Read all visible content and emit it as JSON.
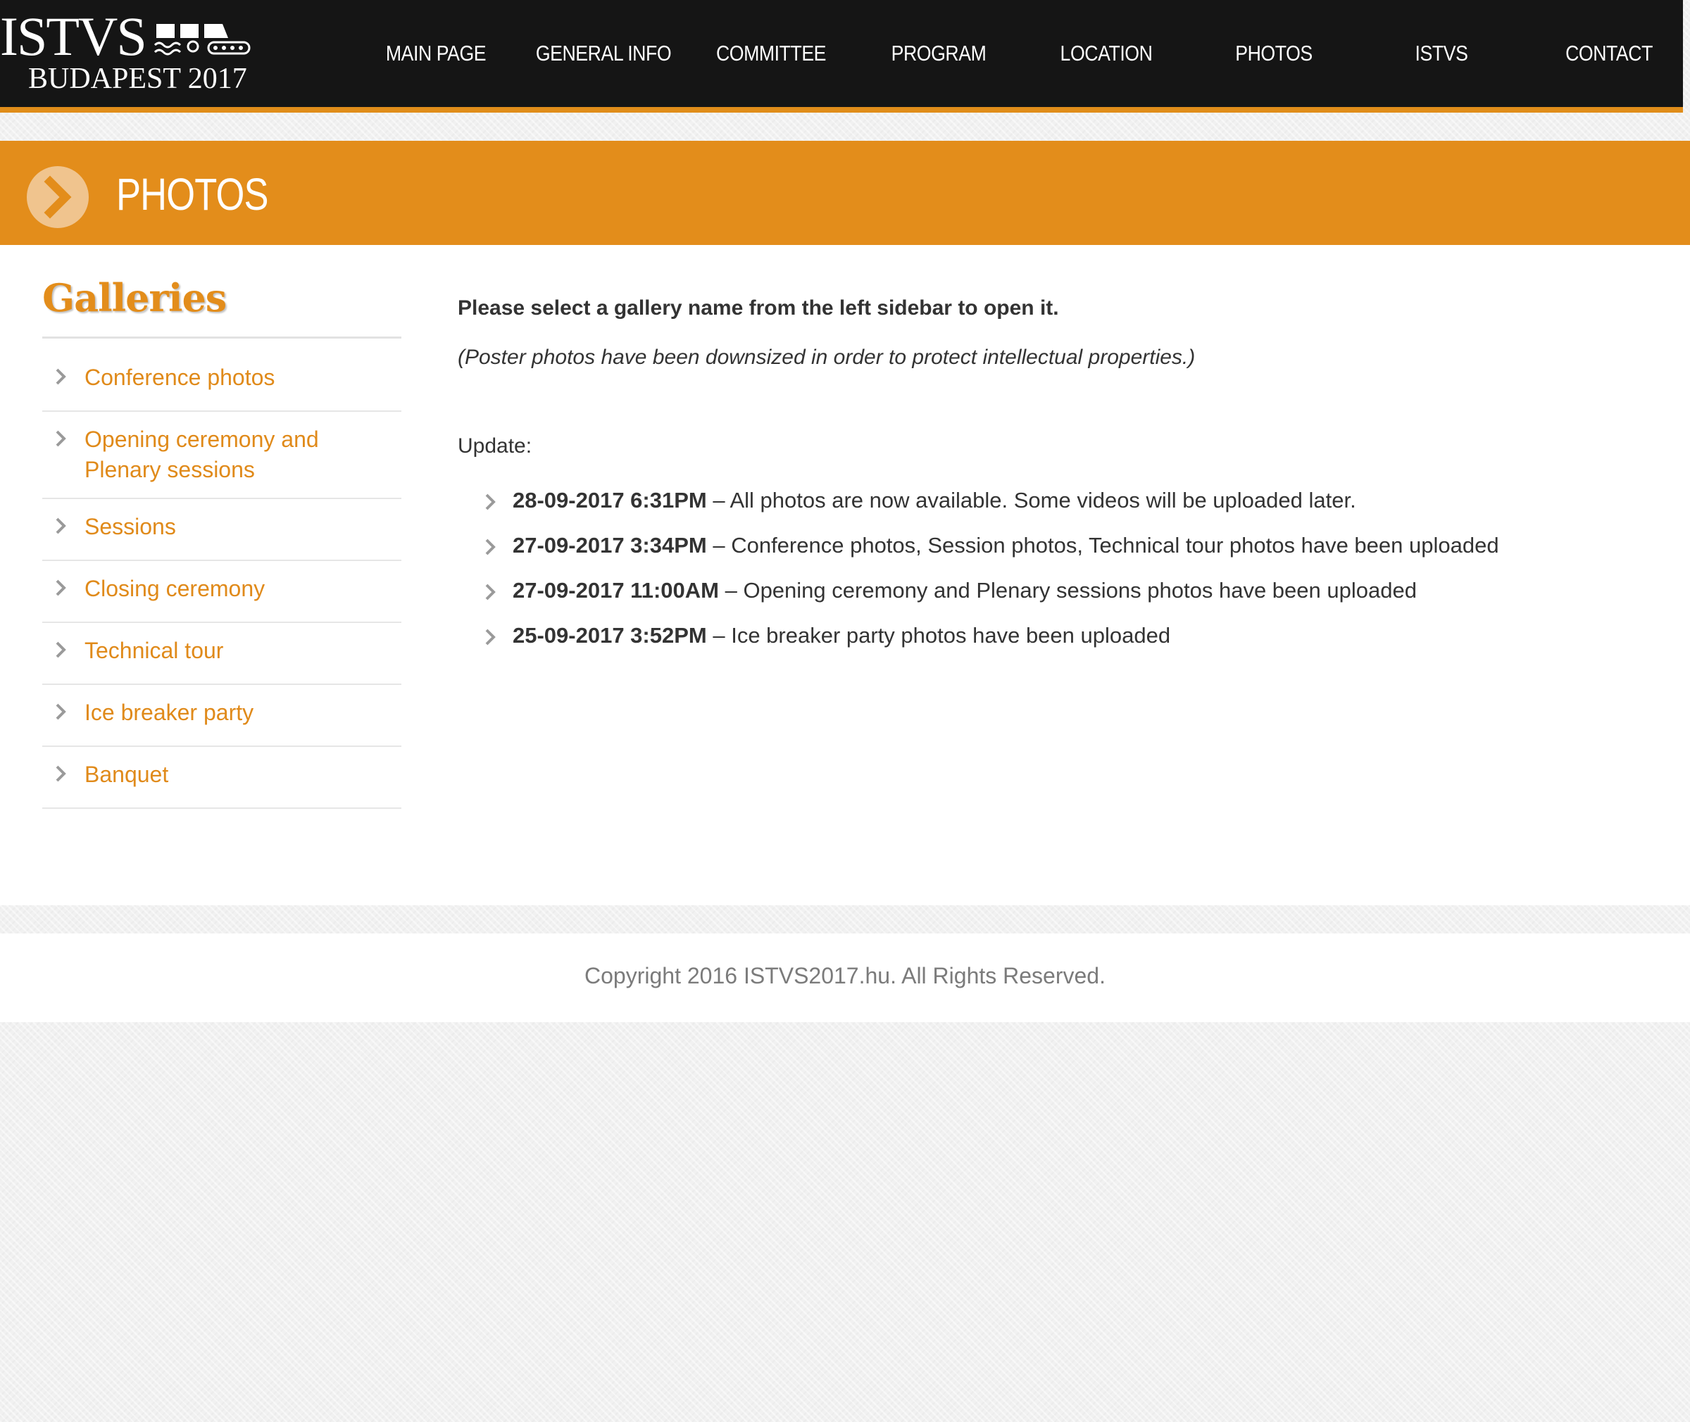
{
  "logo": {
    "line1": "ISTVS",
    "line2": "BUDAPEST 2017"
  },
  "nav": [
    {
      "label": "MAIN PAGE"
    },
    {
      "label": "GENERAL INFO"
    },
    {
      "label": "COMMITTEE"
    },
    {
      "label": "PROGRAM"
    },
    {
      "label": "LOCATION"
    },
    {
      "label": "PHOTOS"
    },
    {
      "label": "ISTVS"
    },
    {
      "label": "CONTACT"
    }
  ],
  "page": {
    "title": "PHOTOS"
  },
  "sidebar": {
    "heading": "Galleries",
    "items": [
      {
        "label": "Conference photos"
      },
      {
        "label": "Opening ceremony and Plenary sessions"
      },
      {
        "label": "Sessions"
      },
      {
        "label": "Closing ceremony"
      },
      {
        "label": "Technical tour"
      },
      {
        "label": "Ice breaker party"
      },
      {
        "label": "Banquet"
      }
    ]
  },
  "main": {
    "intro": "Please select a gallery name from the left sidebar to open it.",
    "note": "(Poster photos have been downsized in order to protect intellectual properties.)",
    "update_label": "Update:",
    "updates": [
      {
        "date": "28-09-2017 6:31PM",
        "text": " – All photos are now available. Some videos will be uploaded later."
      },
      {
        "date": "27-09-2017 3:34PM",
        "text": " – Conference photos, Session photos, Technical tour photos have been uploaded"
      },
      {
        "date": "27-09-2017 11:00AM",
        "text": " – Opening ceremony and Plenary sessions photos have been uploaded"
      },
      {
        "date": "25-09-2017 3:52PM",
        "text": " – Ice breaker party photos have been uploaded"
      }
    ]
  },
  "footer": {
    "copyright": "Copyright 2016 ISTVS2017.hu. All Rights Reserved."
  },
  "colors": {
    "accent": "#e38d1b",
    "header_bg": "#151515",
    "text": "#333333",
    "muted": "#7b7b7b"
  },
  "icons": {
    "title_marker": "chevron-right-circle-icon",
    "list_marker": "chevron-right-icon",
    "logo_mark": "vehicle-track-icon"
  }
}
